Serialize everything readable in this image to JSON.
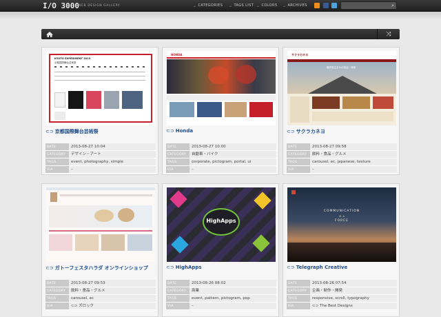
{
  "header": {
    "logo": "I/O 3000",
    "logo_sub": "WEB DESIGN GALLERY",
    "nav": [
      {
        "label": "CATEGORIES"
      },
      {
        "label": "TAGS LIST"
      },
      {
        "label": "COLORS"
      },
      {
        "label": "ARCHIVES"
      }
    ],
    "search_placeholder": ""
  },
  "meta_keys": {
    "date": "DATE",
    "category": "CATEGORY",
    "tags": "TAGS",
    "via": "VIA"
  },
  "cards": [
    {
      "title": "京都国際舞台芸術祭",
      "date": "2013-08-27 10:04",
      "category": "デザイン・アート",
      "tags": "event, photography, simple",
      "via": "–"
    },
    {
      "title": "Honda",
      "date": "2013-08-27 10:00",
      "category": "自動車・バイク",
      "tags": "corporate, pictogram, portal, ui",
      "via": "–"
    },
    {
      "title": "サクラカネヨ",
      "date": "2013-08-27 09:58",
      "category": "飲料・食品・グルメ",
      "tags": "carousel, ec, japanese, texture",
      "via": "–"
    },
    {
      "title": "ガトーフェスタハラダ オンラインショップ",
      "date": "2013-08-27 09:53",
      "category": "飲料・食品・グルメ",
      "tags": "carousel, ec",
      "via": "ズロック"
    },
    {
      "title": "HighApps",
      "date": "2013-08-26 08:02",
      "category": "商業",
      "tags": "event, pattern, pictogram, pop",
      "via": "–"
    },
    {
      "title": "Telegraph Creative",
      "date": "2013-08-26 07:54",
      "category": "企画・制作・開発",
      "tags": "responsive, scroll, typography",
      "via": "The Best Designs"
    }
  ],
  "thumbs": {
    "kyoto_heading": "KYOTO EXPERIMENT 2013",
    "kyoto_sub": "京都国際舞台芸術祭",
    "honda_logo": "HONDA",
    "sakura_logo": "サクラカネヨ",
    "sakura_hero": "鹿児島生まれの醤油・味噌",
    "highapps_logo": "HighApps",
    "telegraph_l1": "COMMUNICATION",
    "telegraph_l2": "IS A",
    "telegraph_l3": "FORCE"
  }
}
